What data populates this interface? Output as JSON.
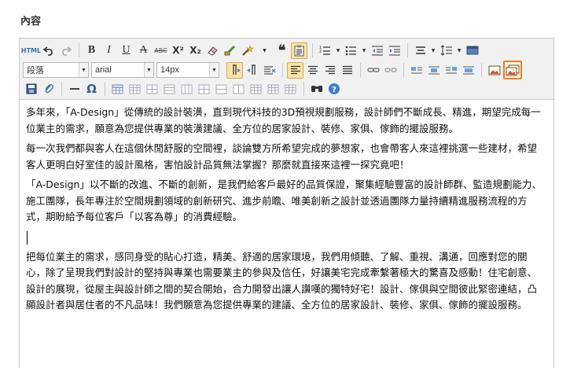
{
  "field": {
    "label": "內容"
  },
  "toolbar": {
    "html_label": "HTML",
    "paragraph_select": "段落",
    "font_select": "arial",
    "size_select": "14px",
    "colors": {
      "active_bg": "#fbe3a8",
      "highlight_border": "#ee7f22",
      "toolbar_bg": "#f1f1f1"
    },
    "icons": {
      "bold": "B",
      "italic": "I",
      "underline": "U",
      "strike": "A",
      "strike_small": "ABC",
      "superscript": "X²",
      "subscript": "X₂",
      "quote": "❝",
      "special_char": "Ω",
      "help": "?",
      "find": "⚲"
    }
  },
  "content": {
    "paragraphs": [
      "多年來，「A-Design」從傳統的設計裝潢，直到現代科技的3D預視規劃服務，設計師們不斷成長、精進，期望完成每一位業主的需求，願意為您提供專業的裝潢建議、全方位的居家設計、裝修、家俱、傢飾的擺設服務。",
      "每一次我們都與客人在這個休閒舒服的空間裡，談論雙方所希望完成的夢想家，也會帶客人來這裡挑選一些建材，希望客人更明白好室佳的設計風格，害怕設計品質無法掌握？那麼就直接來這裡一探究竟吧！",
      "「A-Design」以不斷的改進、不斷的創新，是我們給客戶最好的品質保證，聚集經驗豐富的設計師群、監造規劃能力、施工團隊，長年專注於空間規劃領域的創新研究、進步前瞻、唯美創新之設計並透過團隊力量持續精進服務流程的方式，期盼給予每位客戶「以客為尊」的消費經驗。",
      "把每位業主的需求，感同身受的貼心打造，精美、舒適的居家環境，我們用傾聽、了解、重視、溝通，回應對您的關心，除了呈現我們對設計的堅持與專業也需要業主的參與及信任，好讓美宅完成牽繫著極大的驚喜及感動！住宅創意、設計的展現，從屋主與設計師之間的契合開始，合力開發出讓人讚嘆的獨特好宅！設計、傢俱與空間彼此緊密連結，凸顯設計者與居住者的不凡品味！我們願意為您提供專業的建議、全方位的居家設計、裝修、家俱、傢飾的擺設服務。"
    ]
  }
}
